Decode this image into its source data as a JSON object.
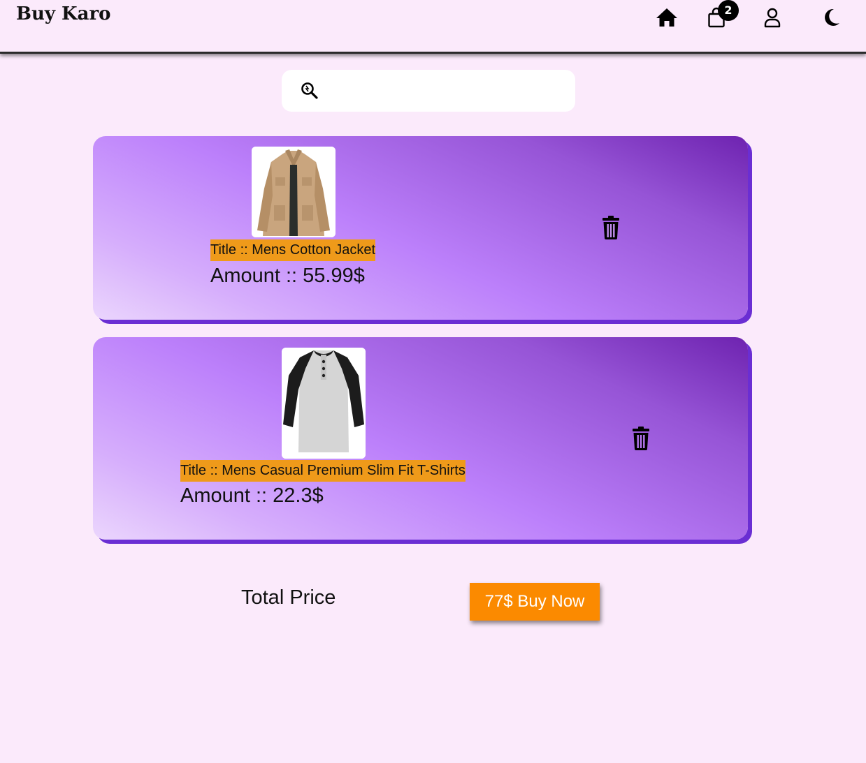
{
  "header": {
    "brand": "Buy Karo",
    "cart_count": "2",
    "icons": [
      "home-icon",
      "cart-icon",
      "user-icon",
      "moon-icon"
    ]
  },
  "search": {
    "placeholder": "",
    "value": "",
    "icon": "search-icon"
  },
  "cart": {
    "items": [
      {
        "title": "Title :: Mens Cotton Jacket",
        "amount": "Amount :: 55.99$",
        "image": "jacket",
        "delete_icon": "trash-icon"
      },
      {
        "title": "Title :: Mens Casual Premium Slim Fit T-Shirts",
        "amount": "Amount :: 22.3$",
        "image": "t-shirt",
        "delete_icon": "trash-icon"
      }
    ]
  },
  "footer": {
    "total_label": "Total Price",
    "buy_button": "77$ Buy Now"
  },
  "colors": {
    "background": "#fbeafb",
    "card_dark": "#6e23b0",
    "card_light": "#ebd6fd",
    "title_highlight": "#ef9a1a",
    "buy_button": "#fb8a00",
    "card_shadow": "#6a2ed3"
  }
}
